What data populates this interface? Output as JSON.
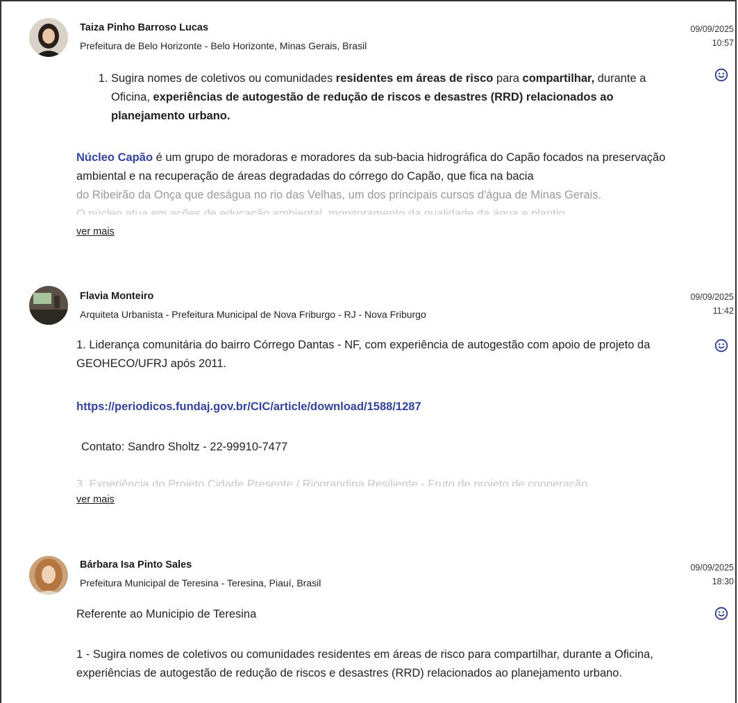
{
  "posts": [
    {
      "author": "Taiza Pinho Barroso Lucas",
      "affiliation": "Prefeitura de Belo Horizonte - Belo Horizonte, Minas Gerais, Brasil",
      "date": "09/09/2025",
      "time": "10:57",
      "q_a": "Sugira nomes de coletivos ou comunidades ",
      "q_b": "residentes em áreas de risco",
      "q_c": " para ",
      "q_d": "compartilhar,",
      "q_e": " durante a Oficina, ",
      "q_f": "experiências de autogestão de redução de riscos e desastres (RRD) relacionados ao planejamento urbano.",
      "link_name": "Núcleo Capão",
      "p1": " é um grupo de moradoras e moradores da sub-bacia hidrográfica do Capão focados na preservação ambiental e na recuperação de áreas degradadas do córrego do Capão, que fica na bacia",
      "p2": "do Ribeirão da Onça que deságua no rio das Velhas, um dos principais cursos d'água de Minas Gerais.",
      "p3": "O núcleo atua em ações de educação ambiental, monitoramento da qualidade da água e plantio",
      "more": "ver mais"
    },
    {
      "author": "Flavia Monteiro",
      "affiliation": "Arquiteta Urbanista - Prefeitura Municipal de Nova Friburgo - RJ - Nova Friburgo",
      "date": "09/09/2025",
      "time": "11:42",
      "p1": "1. Liderança comunitária do bairro Córrego Dantas - NF, com experiência de autogestão com apoio de projeto da GEOHECO/UFRJ após 2011.",
      "link": "https://periodicos.fundaj.gov.br/CIC/article/download/1588/1287",
      "contact": "Contato: Sandro Sholtz - 22-99910-7477",
      "p3": "3. Experiência do Projeto Cidade Presente / Riograndina Resiliente -  Fruto de projeto de cooperação",
      "more": "ver mais"
    },
    {
      "author": "Bárbara Isa Pinto Sales",
      "affiliation": "Prefeitura Municipal de Teresina - Teresina, Piauí, Brasil",
      "date": "09/09/2025",
      "time": "18:30",
      "p1": "Referente ao Municipio de Teresina",
      "p2": "1 - Sugira nomes de coletivos ou comunidades residentes em áreas de risco para compartilhar, durante a Oficina, experiências de autogestão de redução de riscos e desastres (RRD) relacionados ao planejamento urbano."
    }
  ],
  "icons": {
    "reaction": "smiley-icon"
  },
  "colors": {
    "link": "#33449a",
    "emoji": "#2b3a8f"
  }
}
